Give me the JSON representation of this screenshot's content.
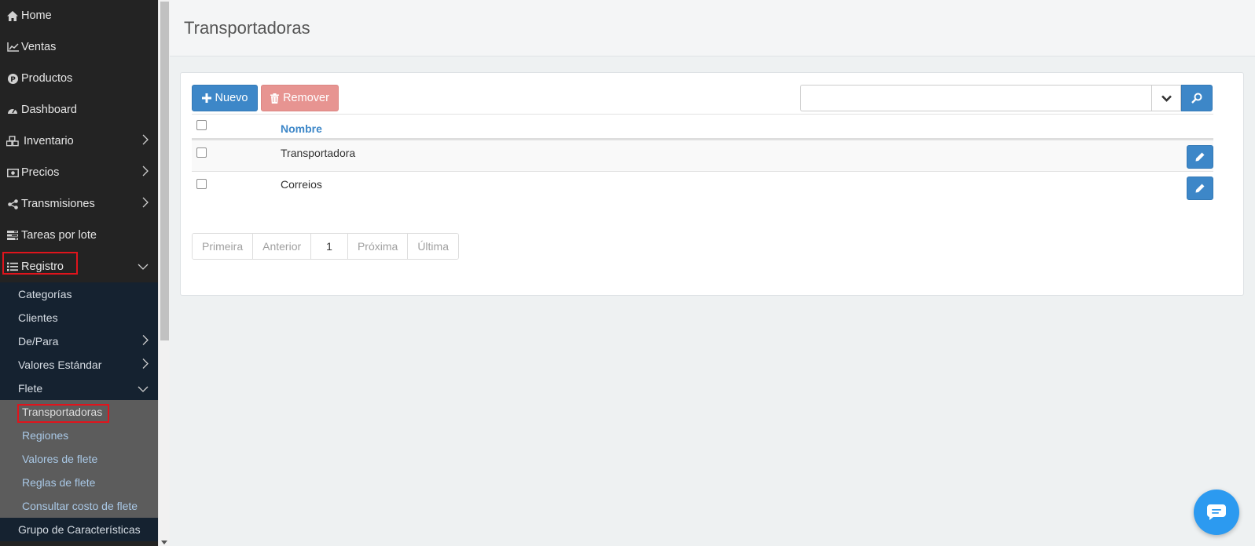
{
  "sidebar": {
    "items": [
      {
        "label": "Home",
        "icon": "home-icon"
      },
      {
        "label": "Ventas",
        "icon": "line-chart-icon"
      },
      {
        "label": "Productos",
        "icon": "product-p-icon"
      },
      {
        "label": "Dashboard",
        "icon": "dashboard-icon"
      },
      {
        "label": "Inventario",
        "icon": "cubes-icon"
      },
      {
        "label": "Precios",
        "icon": "money-icon"
      },
      {
        "label": "Transmisiones",
        "icon": "share-icon"
      },
      {
        "label": "Tareas por lote",
        "icon": "tasks-icon"
      },
      {
        "label": "Registro",
        "icon": "list-icon"
      }
    ],
    "registro_sub": [
      {
        "label": "Categorías"
      },
      {
        "label": "Clientes"
      },
      {
        "label": "De/Para"
      },
      {
        "label": "Valores Estándar"
      },
      {
        "label": "Flete"
      }
    ],
    "flete_sub": [
      {
        "label": "Transportadoras"
      },
      {
        "label": "Regiones"
      },
      {
        "label": "Valores de flete"
      },
      {
        "label": "Reglas de flete"
      },
      {
        "label": "Consultar costo de flete"
      }
    ],
    "after": [
      {
        "label": "Grupo de Características"
      }
    ]
  },
  "page": {
    "title": "Transportadoras"
  },
  "toolbar": {
    "new_label": "Nuevo",
    "remove_label": "Remover"
  },
  "search": {
    "value": "",
    "placeholder": ""
  },
  "table": {
    "header": {
      "name": "Nombre"
    },
    "rows": [
      {
        "name": "Transportadora"
      },
      {
        "name": "Correios"
      }
    ]
  },
  "pagination": {
    "first": "Primeira",
    "prev": "Anterior",
    "current": "1",
    "next": "Próxima",
    "last": "Última"
  },
  "colors": {
    "primary": "#3d87c8",
    "danger": "#e79491",
    "sidebar": "#232323",
    "highlight": "#e0141c"
  }
}
